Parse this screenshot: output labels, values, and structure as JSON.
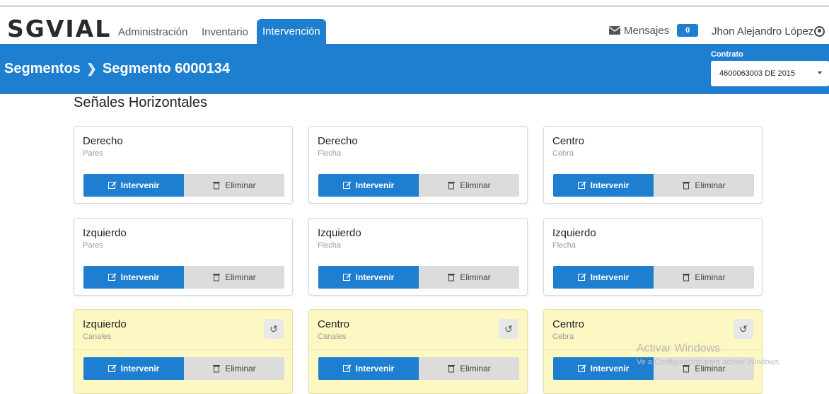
{
  "app": {
    "logo": "SGVIAL"
  },
  "nav": {
    "items": [
      {
        "label": "Administración"
      },
      {
        "label": "Inventario"
      },
      {
        "label": "Intervención"
      }
    ],
    "messages_label": "Mensajes",
    "messages_count": "0",
    "user_name": "Jhon Alejandro López"
  },
  "breadcrumb": {
    "parent": "Segmentos",
    "current": "Segmento 6000134"
  },
  "contract": {
    "label": "Contrato",
    "value": "4600063003 DE 2015"
  },
  "section": {
    "title": "Señales Horizontales"
  },
  "buttons": {
    "intervene": "Intervenir",
    "delete": "Eliminar"
  },
  "cards": [
    {
      "title": "Derecho",
      "subtitle": "Pares"
    },
    {
      "title": "Derecho",
      "subtitle": "Flecha"
    },
    {
      "title": "Centro",
      "subtitle": "Cebra"
    },
    {
      "title": "Izquierdo",
      "subtitle": "Pares"
    },
    {
      "title": "Izquierdo",
      "subtitle": "Flecha"
    },
    {
      "title": "Izquierdo",
      "subtitle": "Flecha"
    },
    {
      "title": "Izquierdo",
      "subtitle": "Canales"
    },
    {
      "title": "Centro",
      "subtitle": "Canales"
    },
    {
      "title": "Centro",
      "subtitle": "Cebra"
    }
  ],
  "watermark": {
    "line1": "Activar Windows",
    "line2": "Ve a Configuración para activar Windows."
  },
  "colors": {
    "primary": "#1e7fd0",
    "highlight_card": "#fdf8c3"
  }
}
